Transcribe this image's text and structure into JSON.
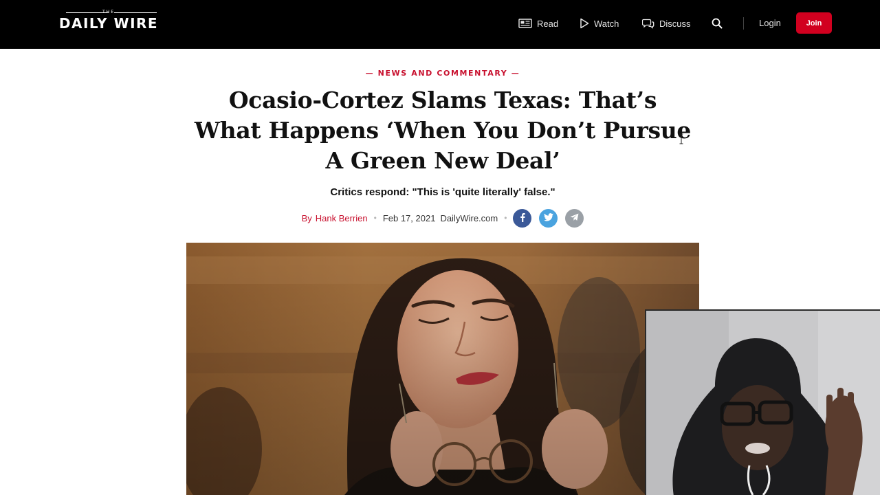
{
  "header": {
    "logo_small": "THE",
    "logo_main": "DAILY WIRE",
    "nav": {
      "read": "Read",
      "watch": "Watch",
      "discuss": "Discuss",
      "login": "Login",
      "join": "Join"
    },
    "icons": [
      "newspaper-icon",
      "play-icon",
      "chat-bubbles-icon",
      "search-icon"
    ]
  },
  "article": {
    "kicker": "— NEWS AND COMMENTARY —",
    "headline": "Ocasio-Cortez Slams Texas: That’s What Happens ‘When You Don’t Pursue A Green New Deal’",
    "dek": "Critics respond: \"This is 'quite literally' false.\"",
    "byline": {
      "by": "By",
      "author": "Hank Berrien",
      "date": "Feb 17, 2021",
      "source": "DailyWire.com"
    },
    "share_icons": [
      "facebook-icon",
      "twitter-icon",
      "telegram-icon"
    ]
  },
  "colors": {
    "header_bg": "#000000",
    "accent_red": "#c8102e",
    "join_red": "#d1001f",
    "facebook": "#3b5998",
    "twitter": "#4aa3df",
    "telegram": "#9aa0a6"
  }
}
